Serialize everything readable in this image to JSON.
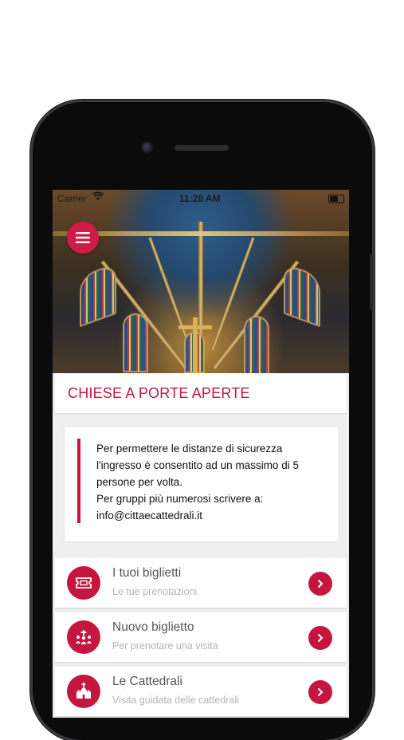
{
  "status_bar": {
    "carrier": "Carrier",
    "time": "11:28 AM"
  },
  "header": {
    "title": "CHIESE A PORTE APERTE"
  },
  "notice": {
    "lines": [
      "Per permettere le distanze di sicurezza",
      "l'ingresso è consentito ad un massimo di 5",
      "persone per volta.",
      "Per gruppi più numerosi scrivere a:",
      "info@cittaecattedrali.it"
    ]
  },
  "menu": {
    "items": [
      {
        "title": "I tuoi biglietti",
        "subtitle": "Le tue prenotazioni",
        "icon": "ticket-icon"
      },
      {
        "title": "Nuovo biglietto",
        "subtitle": "Per prenotare una visita",
        "icon": "church-people-icon"
      },
      {
        "title": "Le Cattedrali",
        "subtitle": "Visita guidata delle cattedrali",
        "icon": "cathedral-icon"
      }
    ]
  },
  "colors": {
    "accent": "#c4163f",
    "background": "#efefef"
  }
}
